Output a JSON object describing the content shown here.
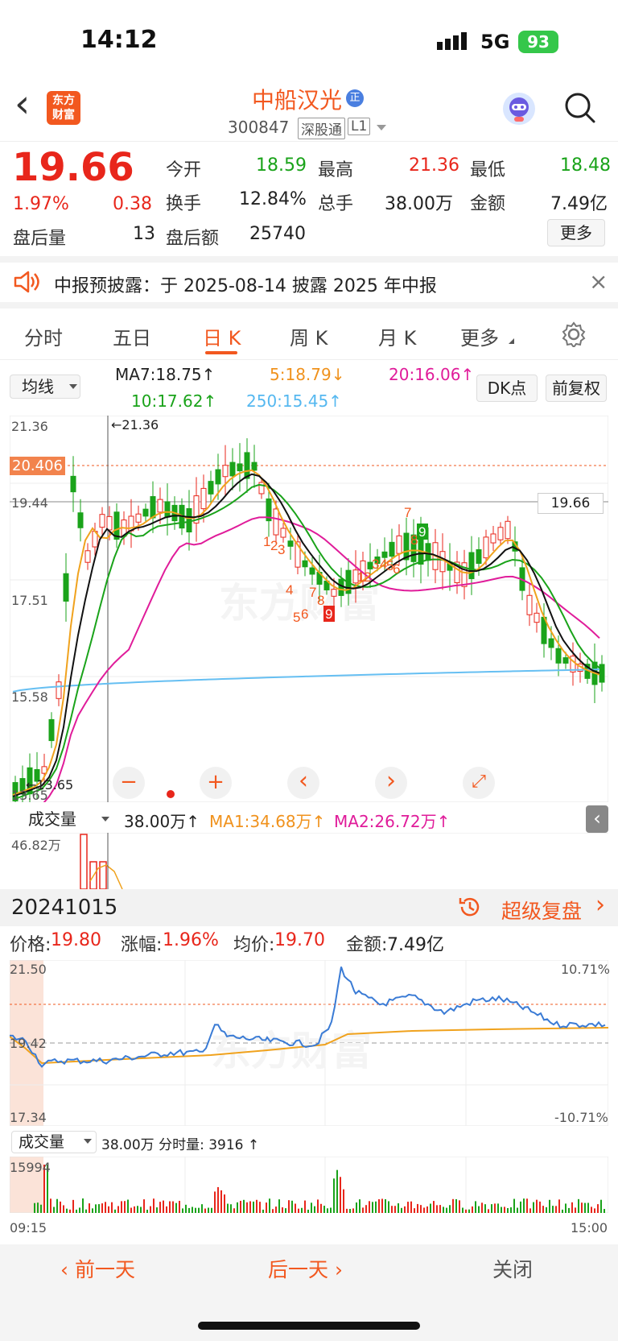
{
  "status_bar": {
    "time": "14:12",
    "network": "5G",
    "battery": "93"
  },
  "header": {
    "back_label": "‹",
    "logo_line1": "东方",
    "logo_line2": "财富",
    "stock_name": "中船汉光",
    "name_badge": "正",
    "stock_code": "300847",
    "tag_market": "深股通",
    "tag_level": "L1"
  },
  "quote": {
    "price": "19.66",
    "change_pct": "1.97%",
    "change": "0.38",
    "open_label": "今开",
    "open": "18.59",
    "high_label": "最高",
    "high": "21.36",
    "low_label": "最低",
    "low": "18.48",
    "turnover_label": "换手",
    "turnover": "12.84%",
    "volume_label": "总手",
    "volume": "38.00万",
    "amount_label": "金额",
    "amount": "7.49亿",
    "after_vol_label": "盘后量",
    "after_vol": "13",
    "after_amt_label": "盘后额",
    "after_amt": "25740",
    "more_label": "更多"
  },
  "notice": {
    "text": "中报预披露：于 2025-08-14 披露 2025 年中报",
    "close": "×"
  },
  "tabs": [
    {
      "label": "分时"
    },
    {
      "label": "五日"
    },
    {
      "label": "日 K"
    },
    {
      "label": "周 K"
    },
    {
      "label": "月 K"
    },
    {
      "label": "更多"
    }
  ],
  "ma_bar": {
    "selector": "均线",
    "ma7": "MA7:18.75↑",
    "ma5": "5:18.79↓",
    "ma20": "20:16.06↑",
    "ma10": "10:17.62↑",
    "ma250": "250:15.45↑",
    "dk_label": "DK点",
    "fq_label": "前复权"
  },
  "kchart": {
    "y_ticks": [
      "21.36",
      "19.44",
      "17.51",
      "15.58",
      "13.65"
    ],
    "high_marker": "←21.36",
    "low_marker": "←13.65",
    "orange_level": "20.406",
    "price_level": "19.66"
  },
  "chart_controls": {
    "minus": "−",
    "plus": "+",
    "left": "‹",
    "right": "›",
    "expand": "⤢"
  },
  "kvolume": {
    "selector": "成交量",
    "vol": "38.00万↑",
    "ma1": "MA1:34.68万↑",
    "ma2": "MA2:26.72万↑",
    "top": "46.82万"
  },
  "review": {
    "date": "20241015",
    "title": "超级复盘",
    "price_label": "价格:",
    "price": "19.80",
    "chg_label": "涨幅:",
    "chg": "1.96%",
    "avg_label": "均价:",
    "avg": "19.70",
    "amt_label": "金额:",
    "amt": "7.49亿"
  },
  "intraday": {
    "y_top": "21.50",
    "y_mid": "19.42",
    "y_bot": "17.34",
    "pct_top": "10.71%",
    "pct_bot": "-10.71%",
    "vol_selector": "成交量",
    "vol_text": "38.00万 分时量: 3916 ↑",
    "vol_top": "15994",
    "t_start": "09:15",
    "t_end": "15:00"
  },
  "bottom_nav": {
    "prev": "‹ 前一天",
    "next": "后一天 ›",
    "close": "关闭"
  },
  "colors": {
    "up": "#e8261b",
    "down": "#1aa31a",
    "accent": "#f0921d",
    "ma20": "#e01c9a",
    "ma250": "#55b8f0"
  }
}
